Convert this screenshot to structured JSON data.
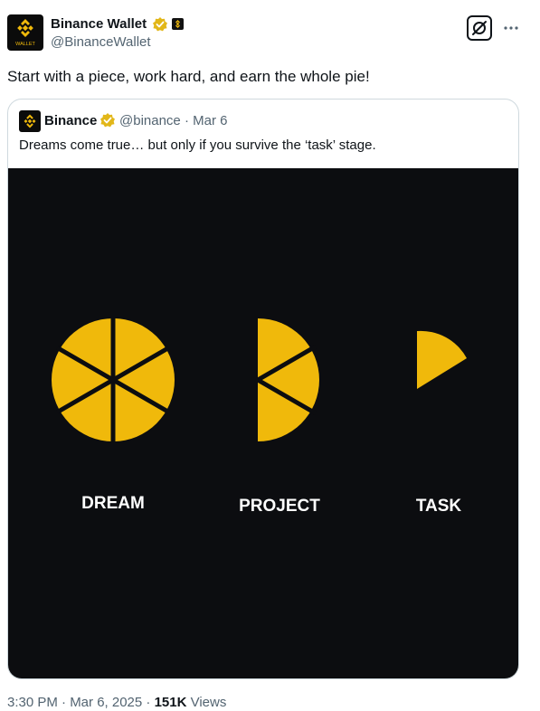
{
  "tweet": {
    "author_name": "Binance Wallet",
    "author_handle": "@BinanceWallet",
    "avatar_caption": "WALLET",
    "text": "Start with a piece, work hard, and earn the whole pie!",
    "timestamp": "3:30 PM · Mar 6, 2025 · ",
    "views_count": "151K",
    "views_label": " Views"
  },
  "quote": {
    "author_name": "Binance",
    "author_handle": "@binance · Mar 6",
    "text": "Dreams come true… but only if you survive the ‘task’ stage.",
    "media": {
      "labels": {
        "dream": "DREAM",
        "project": "PROJECT",
        "task": "TASK"
      },
      "pie_color": "#f0b90b",
      "background": "#0c0d10"
    }
  },
  "icons": {
    "verified": "verified-badge-icon",
    "grok": "grok-icon",
    "more": "more-icon"
  },
  "colors": {
    "binance_yellow": "#f0b90b",
    "verified_gold": "#e2b719",
    "secondary_text": "#536471"
  }
}
